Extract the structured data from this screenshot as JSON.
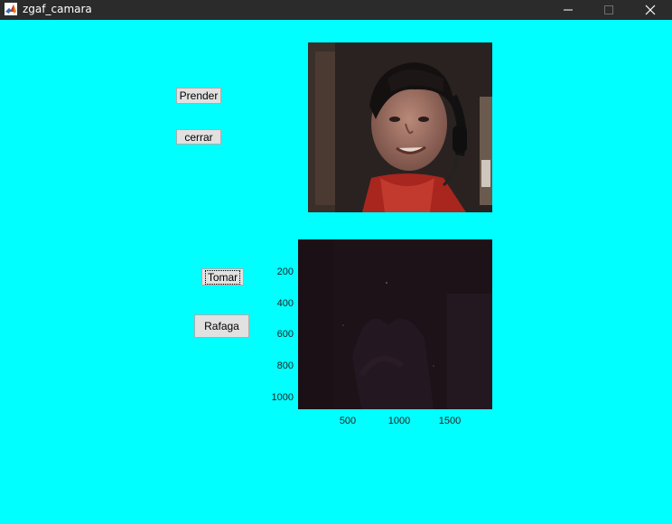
{
  "window": {
    "title": "zgaf_camara",
    "icon": "matlab-icon",
    "controls": [
      "minimize-icon",
      "maximize-icon",
      "close-icon"
    ]
  },
  "colors": {
    "background": "#00ffff",
    "titlebar": "#2b2b2b",
    "button_face": "#e1e1e1"
  },
  "buttons": {
    "prender": "Prender",
    "cerrar": "cerrar",
    "tomar": "Tomar",
    "rafaga": "Rafaga"
  },
  "live_preview": {
    "content": "webcam live video feed"
  },
  "captured_axes": {
    "y_ticks": [
      "200",
      "400",
      "600",
      "800",
      "1000"
    ],
    "x_ticks": [
      "500",
      "1000",
      "1500"
    ]
  }
}
